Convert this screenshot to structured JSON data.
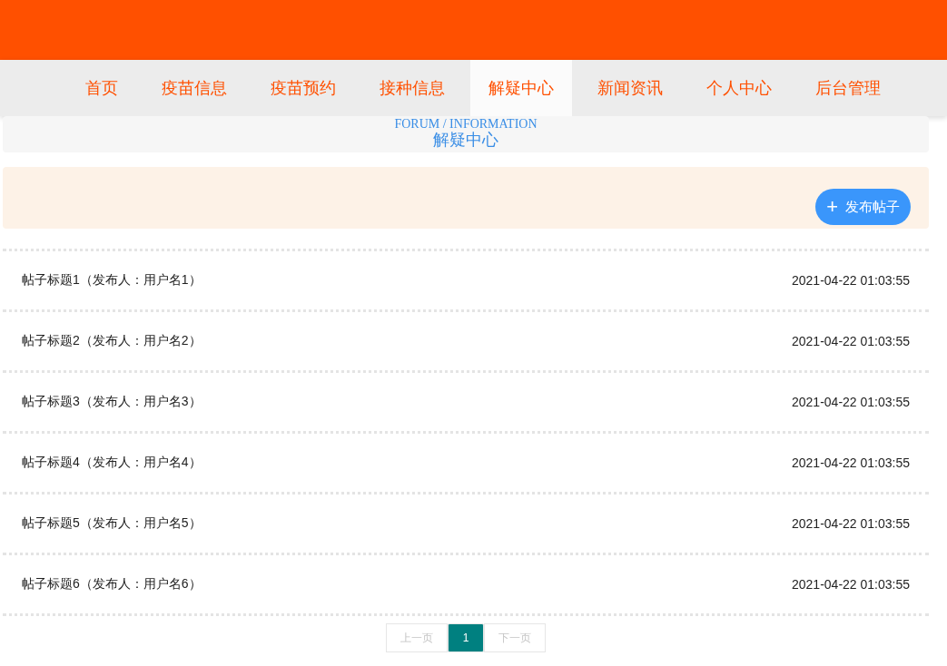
{
  "nav": [
    {
      "label": "首页",
      "selected": false
    },
    {
      "label": "疫苗信息",
      "selected": false
    },
    {
      "label": "疫苗预约",
      "selected": false
    },
    {
      "label": "接种信息",
      "selected": false
    },
    {
      "label": "解疑中心",
      "selected": true
    },
    {
      "label": "新闻资讯",
      "selected": false
    },
    {
      "label": "个人中心",
      "selected": false
    },
    {
      "label": "后台管理",
      "selected": false
    }
  ],
  "section": {
    "subtitle": "FORUM / INFORMATION",
    "title": "解疑中心"
  },
  "toolbar": {
    "add_icon": "+",
    "button": "发布帖子"
  },
  "posts": [
    {
      "title": "帖子标题1（发布人：用户名1）",
      "time": "2021-04-22 01:03:55"
    },
    {
      "title": "帖子标题2（发布人：用户名2）",
      "time": "2021-04-22 01:03:55"
    },
    {
      "title": "帖子标题3（发布人：用户名3）",
      "time": "2021-04-22 01:03:55"
    },
    {
      "title": "帖子标题4（发布人：用户名4）",
      "time": "2021-04-22 01:03:55"
    },
    {
      "title": "帖子标题5（发布人：用户名5）",
      "time": "2021-04-22 01:03:55"
    },
    {
      "title": "帖子标题6（发布人：用户名6）",
      "time": "2021-04-22 01:03:55"
    }
  ],
  "pagination": {
    "prev": {
      "label": "上一页",
      "disabled": true
    },
    "pages": [
      {
        "label": "1",
        "selected": true
      }
    ],
    "next": {
      "label": "下一页",
      "disabled": true
    }
  }
}
